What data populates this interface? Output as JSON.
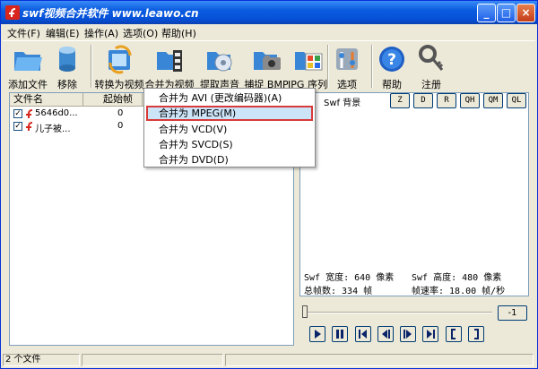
{
  "window": {
    "title": "swf视频合并软件 www.leawo.cn",
    "minimize": "_",
    "maximize": "□",
    "close": "×"
  },
  "menu": [
    "文件(F)",
    "编辑(E)",
    "操作(A)",
    "选项(O)",
    "帮助(H)"
  ],
  "toolbar": [
    {
      "label": "添加文件",
      "icon": "add-folder-icon"
    },
    {
      "label": "移除",
      "icon": "remove-db-icon"
    },
    {
      "label": "转换为视频",
      "icon": "convert-video-icon"
    },
    {
      "label": "合并为视频",
      "icon": "merge-video-icon"
    },
    {
      "label": "提取声音",
      "icon": "extract-audio-icon"
    },
    {
      "label": "捕捉 BMP",
      "icon": "capture-bmp-icon"
    },
    {
      "label": "JPG 序列",
      "icon": "jpg-sequence-icon"
    },
    {
      "label": "选项",
      "icon": "options-icon"
    },
    {
      "label": "帮助",
      "icon": "help-icon"
    },
    {
      "label": "注册",
      "icon": "register-key-icon"
    }
  ],
  "file_list": {
    "columns": [
      "文件名",
      "起始帧"
    ],
    "rows": [
      {
        "name": "5646d0...",
        "start": "0",
        "checked": true
      },
      {
        "name": "儿子被...",
        "start": "0",
        "checked": true
      }
    ]
  },
  "dropdown": {
    "items": [
      "合并为 AVI (更改编码器)(A)",
      "合并为 MPEG(M)",
      "合并为 VCD(V)",
      "合并为 SVCD(S)",
      "合并为 DVD(D)"
    ],
    "selected_index": 1
  },
  "preview": {
    "bg_label": "Swf 背景",
    "quality_buttons": [
      "Z",
      "D",
      "R",
      "QH",
      "QM",
      "QL"
    ],
    "width_label": "Swf 宽度: 640 像素",
    "height_label": "Swf 高度: 480 像素",
    "frames_label": "总帧数: 334 帧",
    "rate_label": "帧速率: 18.00 帧/秒"
  },
  "player": {
    "minus_label": "-1",
    "controls": [
      "play-icon",
      "pause-icon",
      "first-frame-icon",
      "prev-frame-icon",
      "next-frame-icon",
      "last-frame-icon",
      "mark-in-icon",
      "mark-out-icon"
    ]
  },
  "status": {
    "count": "2 个文件"
  },
  "colors": {
    "title_bar": "#0a5ce0",
    "face": "#ece9d8",
    "highlight": "#d83a3a",
    "selected_bg": "#cce4f7"
  }
}
